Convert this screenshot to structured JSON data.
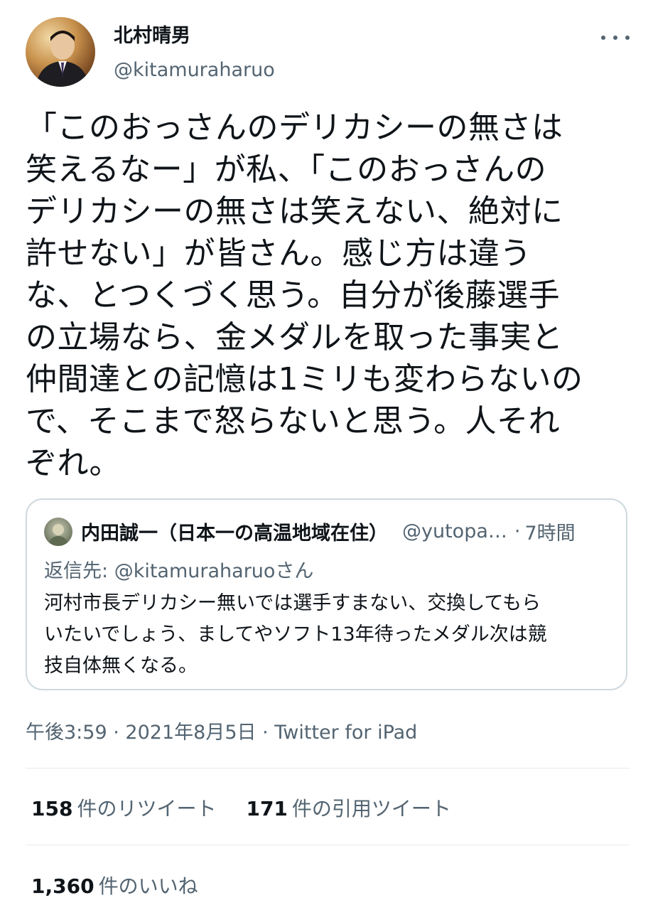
{
  "user": {
    "display_name": "北村晴男",
    "handle": "@kitamuraharuo"
  },
  "tweet": {
    "text": "「このおっさんのデリカシーの無さは\n笑えるなー」が私、「このおっさんの\nデリカシーの無さは笑えない、絶対に\n許せない」が皆さん。感じ方は違う\nな、とつくづく思う。自分が後藤選手\nの立場なら、金メダルを取った事実と\n仲間達との記憶は1ミリも変わらないの\nで、そこまで怒らないと思う。人それ\nぞれ。"
  },
  "quote": {
    "name": "内田誠一（日本一の高温地域在住）",
    "handle": "@yutopa…",
    "separator": "·",
    "time": "7時間",
    "reply_label": "返信先:",
    "reply_handle": "@kitamuraharuoさん",
    "text": "河村市長デリカシー無いでは選手すまない、交換してもら\nいたいでしょう、ましてやソフト13年待ったメダル次は競\n技自体無くなる。"
  },
  "meta": {
    "time": "午後3:59",
    "sep1": "·",
    "date": "2021年8月5日",
    "sep2": "·",
    "source": "Twitter for iPad"
  },
  "stats": {
    "retweets": {
      "count": "158",
      "label": "件のリツイート"
    },
    "quotes": {
      "count": "171",
      "label": "件の引用ツイート"
    },
    "likes": {
      "count": "1,360",
      "label": "件のいいね"
    }
  },
  "colors": {
    "text": "#0f1419",
    "secondary": "#536471",
    "border": "#cfd9de"
  },
  "icons": {
    "more": "more-dots-icon"
  }
}
